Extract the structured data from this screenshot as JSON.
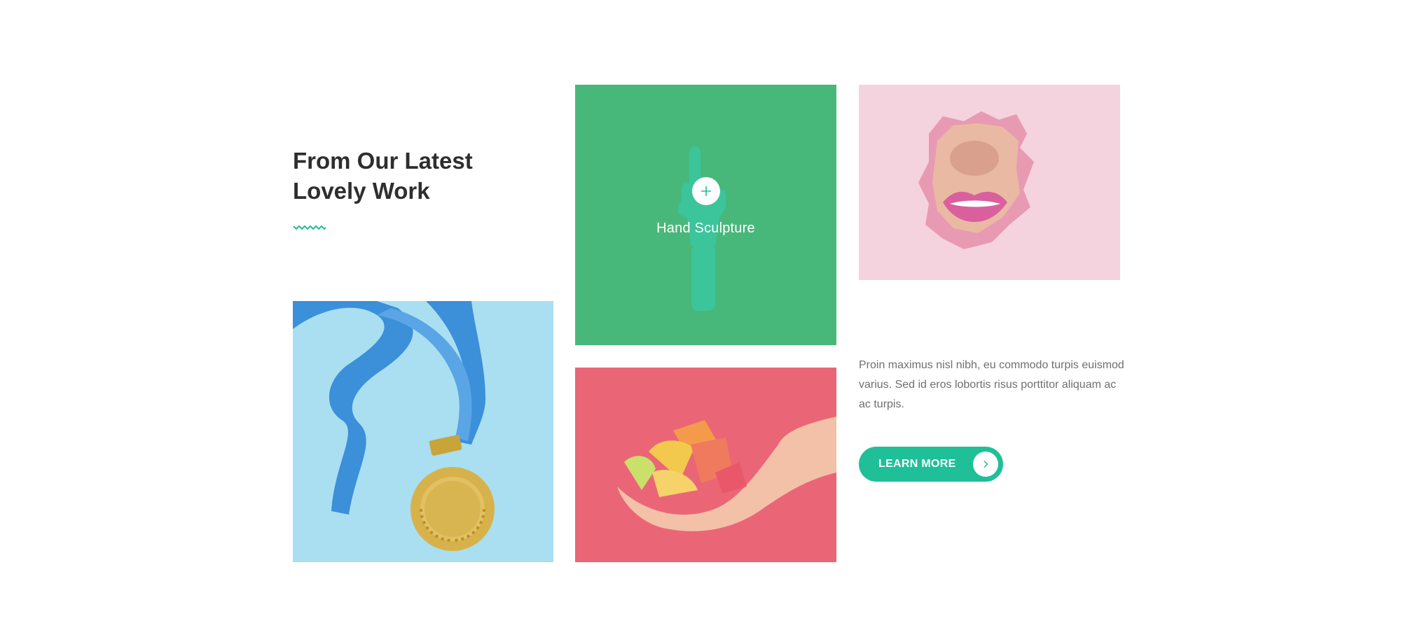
{
  "section": {
    "title": "From Our  Latest\nLovely Work",
    "accent_color": "#1fbf98"
  },
  "portfolio": {
    "items": [
      {
        "image": "gold-medal-blue-ribbon",
        "background": "#a9dff0"
      },
      {
        "image": "green-wooden-hand",
        "background": "#48b87a",
        "caption": "Hand Sculpture",
        "overlay_icon": "plus-icon"
      },
      {
        "image": "pink-lips-torn-paper",
        "background": "#f5d3de"
      },
      {
        "image": "hand-holding-candy",
        "background": "#ea6677"
      }
    ]
  },
  "about": {
    "description": "Proin maximus nisl nibh, eu commodo turpis euismod varius. Sed id eros lobortis risus porttitor aliquam ac ac turpis.",
    "button_label": "LEARN MORE",
    "button_icon": "chevron-right-icon"
  }
}
